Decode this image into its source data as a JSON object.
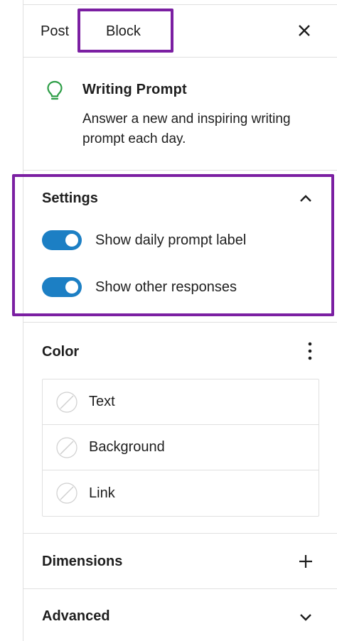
{
  "tabs": {
    "post_label": "Post",
    "block_label": "Block",
    "active": "Block"
  },
  "block": {
    "icon": "lightbulb-icon",
    "title": "Writing Prompt",
    "description": "Answer a new and inspiring writing prompt each day."
  },
  "settings": {
    "title": "Settings",
    "expanded": true,
    "toggles": [
      {
        "label": "Show daily prompt label",
        "checked": true
      },
      {
        "label": "Show other responses",
        "checked": true
      }
    ]
  },
  "color": {
    "title": "Color",
    "items": [
      {
        "label": "Text"
      },
      {
        "label": "Background"
      },
      {
        "label": "Link"
      }
    ]
  },
  "dimensions": {
    "title": "Dimensions"
  },
  "advanced": {
    "title": "Advanced"
  },
  "colors": {
    "accent_toggle": "#1c7fc4",
    "tab_underline": "#3858e9",
    "highlight_box": "#7b1fa2",
    "icon_green": "#2e9e47"
  }
}
